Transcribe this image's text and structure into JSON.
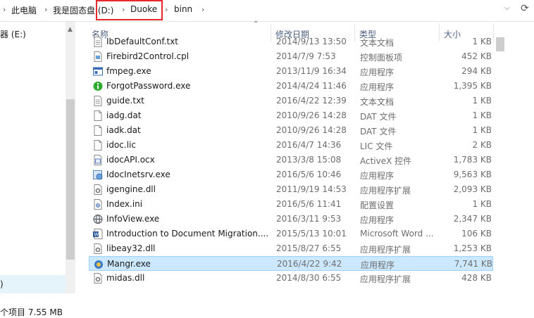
{
  "breadcrumb": {
    "items": [
      "此电脑",
      "我是固态盘 (D:)",
      "Duoke",
      "binn"
    ]
  },
  "nav": {
    "drive_label": "器 (E:)",
    "selected_label": ")",
    "status": "个项目  7.55 MB"
  },
  "columns": {
    "name": "名称",
    "date": "修改日期",
    "type": "类型",
    "size": "大小"
  },
  "files": [
    {
      "name": "IbDefaultConf.txt",
      "date": "2014/9/13 13:50",
      "type": "文本文档",
      "size": "1 KB",
      "icon": "text-file-icon"
    },
    {
      "name": "Firebird2Control.cpl",
      "date": "2014/7/9 7:53",
      "type": "控制面板项",
      "size": "452 KB",
      "icon": "control-panel-icon"
    },
    {
      "name": "fmpeg.exe",
      "date": "2013/11/9 16:34",
      "type": "应用程序",
      "size": "294 KB",
      "icon": "app-window-icon"
    },
    {
      "name": "ForgotPassword.exe",
      "date": "2014/4/24 11:46",
      "type": "应用程序",
      "size": "1,395 KB",
      "icon": "info-green-icon"
    },
    {
      "name": "guide.txt",
      "date": "2016/4/22 12:39",
      "type": "文本文档",
      "size": "1 KB",
      "icon": "text-file-icon"
    },
    {
      "name": "iadg.dat",
      "date": "2010/9/26 14:28",
      "type": "DAT 文件",
      "size": "1 KB",
      "icon": "blank-file-icon"
    },
    {
      "name": "iadk.dat",
      "date": "2010/9/26 14:28",
      "type": "DAT 文件",
      "size": "1 KB",
      "icon": "blank-file-icon"
    },
    {
      "name": "idoc.lic",
      "date": "2016/4/7 14:36",
      "type": "LIC 文件",
      "size": "2 KB",
      "icon": "blank-file-icon"
    },
    {
      "name": "idocAPI.ocx",
      "date": "2013/3/8 15:08",
      "type": "ActiveX 控件",
      "size": "1,783 KB",
      "icon": "activex-icon"
    },
    {
      "name": "IdocInetsrv.exe",
      "date": "2016/5/6 10:46",
      "type": "应用程序",
      "size": "9,563 KB",
      "icon": "service-app-icon"
    },
    {
      "name": "igengine.dll",
      "date": "2011/9/19 14:53",
      "type": "应用程序扩展",
      "size": "2,093 KB",
      "icon": "dll-gear-icon"
    },
    {
      "name": "Index.ini",
      "date": "2016/5/6 11:41",
      "type": "配置设置",
      "size": "1 KB",
      "icon": "ini-settings-icon"
    },
    {
      "name": "InfoView.exe",
      "date": "2016/3/11 9:53",
      "type": "应用程序",
      "size": "2,347 KB",
      "icon": "globe-app-icon"
    },
    {
      "name": "Introduction to Document Migration....",
      "date": "2015/5/13 10:01",
      "type": "Microsoft Word ...",
      "size": "106 KB",
      "icon": "word-document-icon"
    },
    {
      "name": "libeay32.dll",
      "date": "2015/8/27 6:55",
      "type": "应用程序扩展",
      "size": "1,253 KB",
      "icon": "dll-gear-icon"
    },
    {
      "name": "Mangr.exe",
      "date": "2016/4/22 9:42",
      "type": "应用程序",
      "size": "7,741 KB",
      "icon": "mangr-app-icon",
      "selected": true
    },
    {
      "name": "midas.dll",
      "date": "2014/8/30 6:55",
      "type": "应用程序扩展",
      "size": "428 KB",
      "icon": "dll-gear-icon"
    }
  ],
  "colors": {
    "highlight_box": "#e8262b",
    "selection_bg": "#cce8ff",
    "header_text": "#4d6082"
  }
}
